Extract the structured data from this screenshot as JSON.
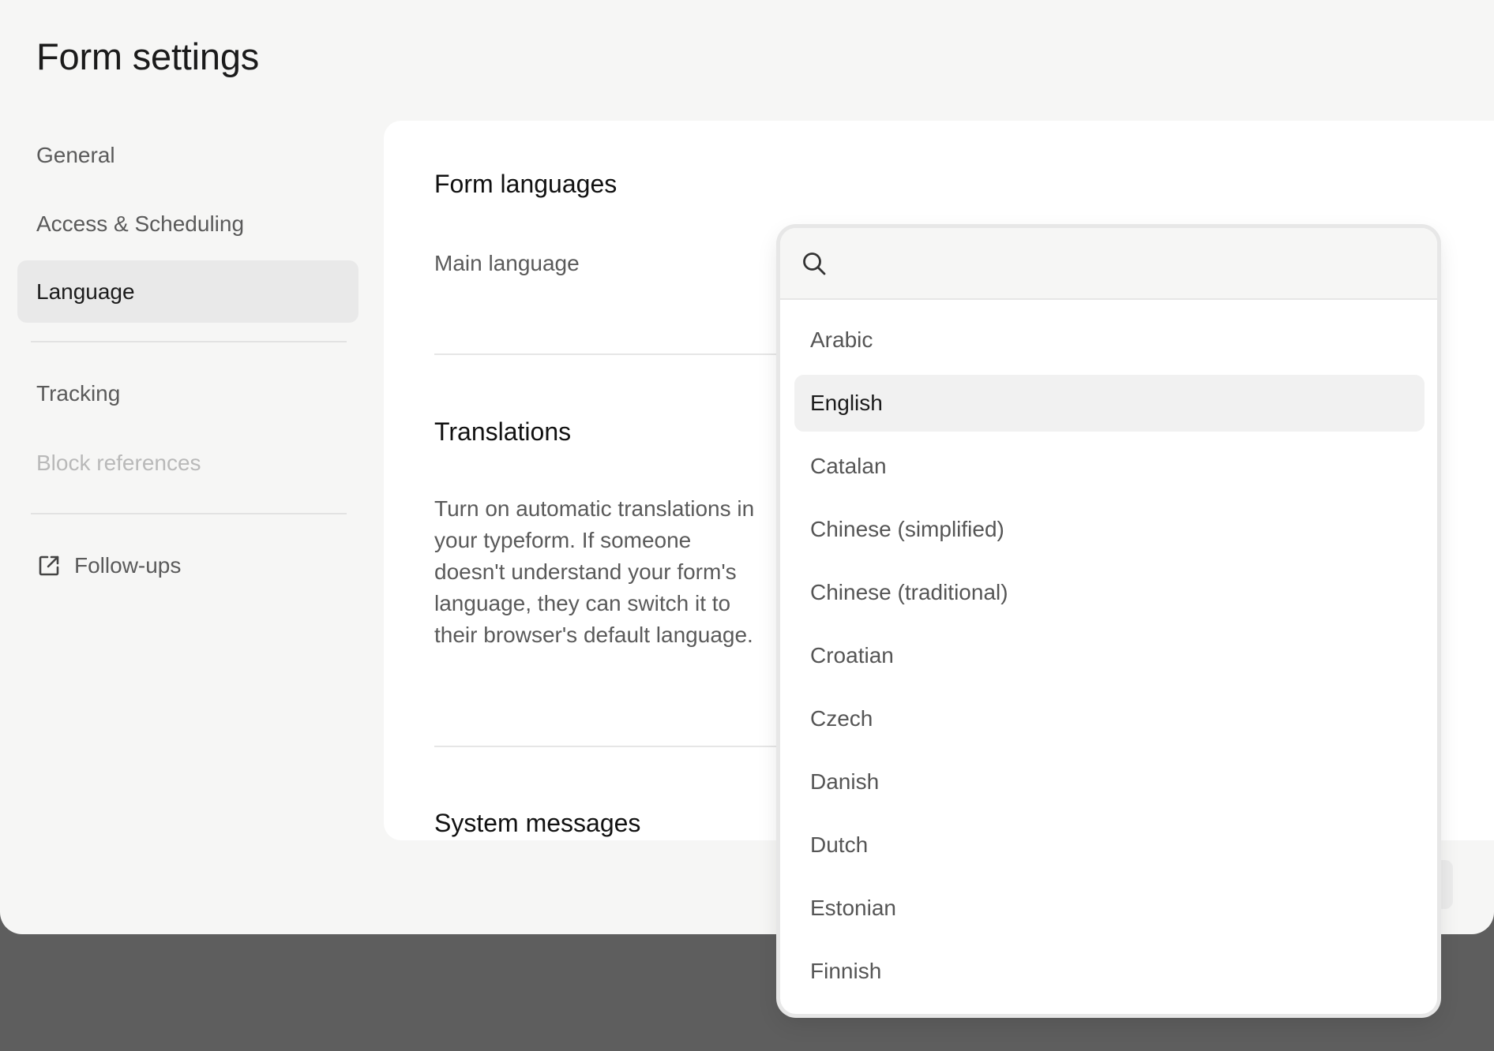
{
  "page": {
    "title": "Form settings"
  },
  "sidebar": {
    "items": [
      {
        "label": "General",
        "state": "default"
      },
      {
        "label": "Access & Scheduling",
        "state": "default"
      },
      {
        "label": "Language",
        "state": "active"
      },
      {
        "label": "Tracking",
        "state": "default"
      },
      {
        "label": "Block references",
        "state": "disabled"
      },
      {
        "label": "Follow-ups",
        "state": "default",
        "icon": "external-link-icon"
      }
    ]
  },
  "main": {
    "form_languages": {
      "heading": "Form languages",
      "main_language_label": "Main language"
    },
    "translations": {
      "heading": "Translations",
      "description": "Turn on automatic translations in your typeform. If someone doesn't understand your form's language, they can switch it to their browser's default language."
    },
    "system_messages": {
      "heading": "System messages"
    }
  },
  "language_dropdown": {
    "search": {
      "placeholder": "",
      "value": "",
      "icon": "search-icon"
    },
    "selected": "English",
    "options": [
      "Arabic",
      "English",
      "Catalan",
      "Chinese (simplified)",
      "Chinese (traditional)",
      "Croatian",
      "Czech",
      "Danish",
      "Dutch",
      "Estonian",
      "Finnish"
    ]
  },
  "colors": {
    "page_background": "#f6f6f5",
    "card_background": "#ffffff",
    "backdrop": "#5e5e5e",
    "active_item": "#e9e9e9",
    "disabled_text": "#b9b9b9"
  }
}
